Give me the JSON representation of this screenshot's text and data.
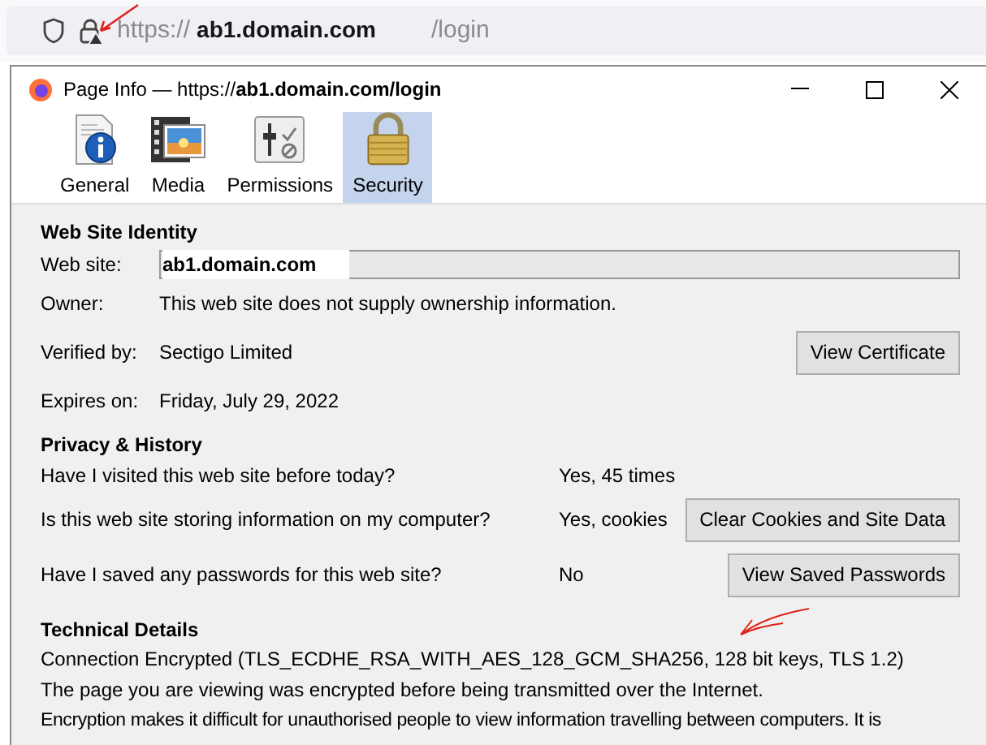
{
  "address_bar": {
    "scheme": "https://",
    "host": "ab1.domain.com",
    "path": "/login"
  },
  "window": {
    "title": "Page Info — https://**ab1.domain.com/login**"
  },
  "tabs": [
    {
      "label": "General",
      "kind": "general",
      "selected": false
    },
    {
      "label": "Media",
      "kind": "media",
      "selected": false
    },
    {
      "label": "Permissions",
      "kind": "permissions",
      "selected": false
    },
    {
      "label": "Security",
      "kind": "security",
      "selected": true
    }
  ],
  "identity": {
    "heading": "Web Site Identity",
    "rows": [
      {
        "label": "Web site:",
        "value": "ab1.domain.com",
        "kind": "field"
      },
      {
        "label": "Owner:",
        "value": "This web site does not supply ownership information.",
        "kind": "text"
      },
      {
        "label": "Verified by:",
        "value": "Sectigo Limited",
        "kind": "text",
        "button": "View Certificate"
      },
      {
        "label": "Expires on:",
        "value": "Friday, July 29, 2022",
        "kind": "text"
      }
    ]
  },
  "privacy": {
    "heading": "Privacy & History",
    "rows": [
      {
        "question": "Have I visited this web site before today?",
        "answer": "Yes, 45 times"
      },
      {
        "question": "Is this web site storing information on my computer?",
        "answer": "Yes, cookies",
        "button": "Clear Cookies and Site Data"
      },
      {
        "question": "Have I saved any passwords for this web site?",
        "answer": "No",
        "button": "View Saved Passwords"
      }
    ]
  },
  "technical": {
    "heading": "Technical Details",
    "lines": [
      "Connection Encrypted (TLS_ECDHE_RSA_WITH_AES_128_GCM_SHA256, 128 bit keys, TLS 1.2)",
      "The page you are viewing was encrypted before being transmitted over the Internet.",
      "Encryption makes it difficult for unauthorised people to view information travelling between computers. It is"
    ]
  }
}
